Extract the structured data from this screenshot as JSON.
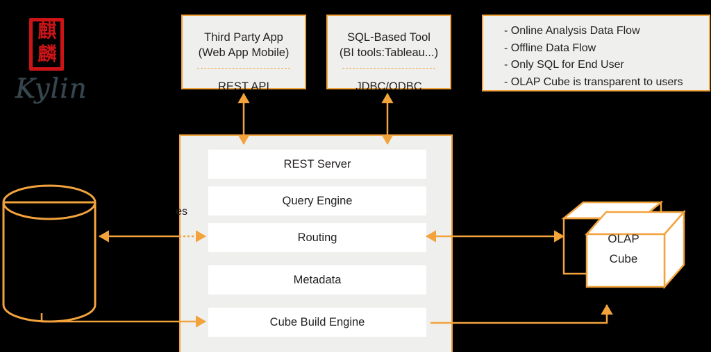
{
  "colors": {
    "background": "#000000",
    "accent_orange": "#f2a33c",
    "panel_fill": "#efefed",
    "box_fill": "#ffffff",
    "text": "#231f20",
    "seal_red": "#cc1417",
    "wordmark": "#37474f"
  },
  "logo": {
    "seal_char_top": "麒",
    "seal_char_bottom": "麟",
    "wordmark": "Kylin"
  },
  "top_boxes": [
    {
      "id": "third-party-app",
      "line1": "Third Party App",
      "line2": "(Web App Mobile)",
      "line3": "REST API"
    },
    {
      "id": "sql-based-tool",
      "line1": "SQL-Based Tool",
      "line2": "(BI tools:Tableau...)",
      "line3": "JDBC/ODBC"
    }
  ],
  "notes": {
    "lines": [
      "- Online Analysis Data Flow",
      "- Offline Data Flow",
      "- Only SQL for End User",
      "- OLAP Cube is transparent to users"
    ]
  },
  "core": {
    "components": [
      {
        "label": "REST Server"
      },
      {
        "label": "Query Engine"
      },
      {
        "label": "Routing"
      },
      {
        "label": "Metadata"
      },
      {
        "label": "Cube Build Engine"
      }
    ],
    "clipped_side_label": "es"
  },
  "datastore": {
    "shape": "cylinder",
    "label": ""
  },
  "cube": {
    "label_line1": "OLAP",
    "label_line2": "Cube"
  }
}
